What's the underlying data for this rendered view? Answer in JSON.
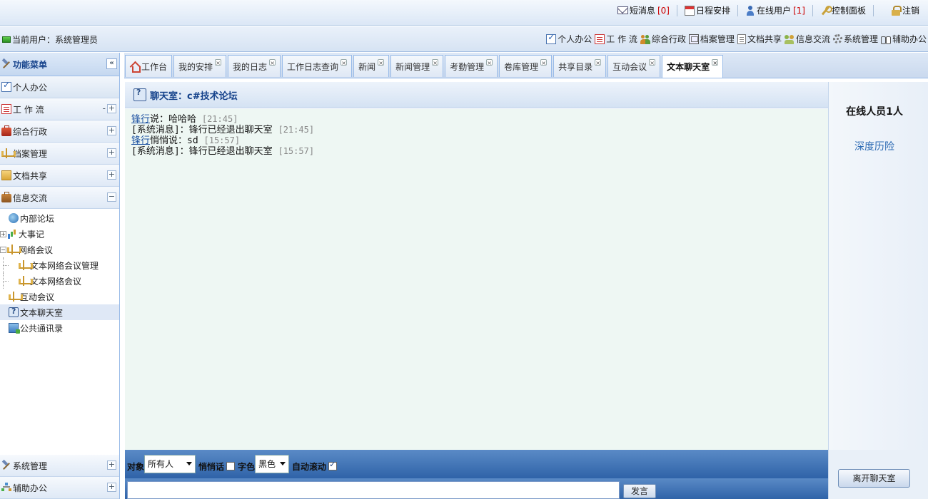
{
  "top_links": {
    "messages_label": "短消息",
    "messages_count": "[0]",
    "schedule_label": "日程安排",
    "online_label": "在线用户",
    "online_count": "[1]",
    "control_panel_label": "控制面板",
    "logout_label": "注销"
  },
  "userbar": {
    "current_user": "当前用户：系统管理员",
    "modules": [
      "个人办公",
      "工 作 流",
      "综合行政",
      "档案管理",
      "文档共享",
      "信息交流",
      "系统管理",
      "辅助办公"
    ]
  },
  "sidebar": {
    "header": "功能菜单",
    "collapse_glyph": "«",
    "sections": [
      {
        "label": "个人办公",
        "tool": ""
      },
      {
        "label": "工 作 流",
        "tool": "+"
      },
      {
        "label": "综合行政",
        "tool": "+"
      },
      {
        "label": "档案管理",
        "tool": "+"
      },
      {
        "label": "文档共享",
        "tool": "+"
      },
      {
        "label": "信息交流",
        "tool": "−"
      }
    ],
    "tree": [
      {
        "label": "内部论坛"
      },
      {
        "label": "大事记",
        "expander": "+"
      },
      {
        "label": "网络会议",
        "expander": "−"
      },
      {
        "label": "文本网络会议管理"
      },
      {
        "label": "文本网络会议"
      },
      {
        "label": "互动会议"
      },
      {
        "label": "文本聊天室"
      },
      {
        "label": "公共通讯录"
      }
    ],
    "bottom_sections": [
      {
        "label": "系统管理",
        "tool": "+"
      },
      {
        "label": "辅助办公",
        "tool": "+"
      }
    ]
  },
  "tabs": [
    "工作台",
    "我的安排",
    "我的日志",
    "工作日志查询",
    "新闻",
    "新闻管理",
    "考勤管理",
    "卷库管理",
    "共享目录",
    "互动会议",
    "文本聊天室"
  ],
  "tab_close_glyph": "×",
  "chat": {
    "title": "聊天室：c#技术论坛",
    "messages": [
      {
        "who": "锋行",
        "text": "说：哈哈哈",
        "time": "[21:45]"
      },
      {
        "who": "",
        "text": "[系统消息]：锋行已经退出聊天室",
        "time": "[21:45]"
      },
      {
        "who": "锋行",
        "text": "悄悄说：sd",
        "time": "[15:57]"
      },
      {
        "who": "",
        "text": "[系统消息]：锋行已经退出聊天室",
        "time": "[15:57]"
      }
    ]
  },
  "online": {
    "title": "在线人员1人",
    "users": [
      "深度历险"
    ]
  },
  "input_bar": {
    "target_label": "对象",
    "target_value": "所有人",
    "whisper_label": "悄悄话",
    "whisper_checked": false,
    "color_label": "字色",
    "color_value": "黑色",
    "autoscroll_label": "自动滚动",
    "autoscroll_checked": true,
    "message_value": "",
    "send_label": "发言",
    "leave_label": "离开聊天室"
  },
  "colors": {
    "accent": "#15428b",
    "input_bar": "#3e70b2",
    "chat_bg": "#eef7f3",
    "link": "#2d6bb4"
  }
}
